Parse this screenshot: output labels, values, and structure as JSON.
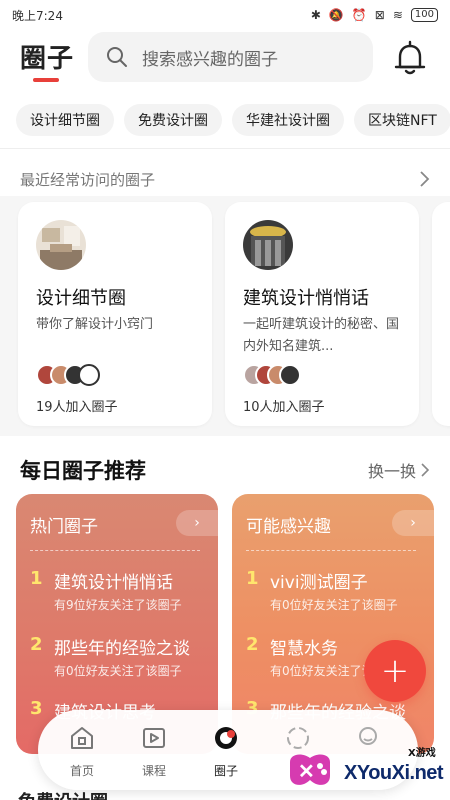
{
  "status": {
    "time": "晚上7:24",
    "battery": "100"
  },
  "header": {
    "title": "圈子",
    "search_placeholder": "搜索感兴趣的圈子"
  },
  "chips": [
    "设计细节圈",
    "免费设计圈",
    "华建社设计圈",
    "区块链NFT"
  ],
  "recent": {
    "heading": "最近经常访问的圈子",
    "cards": [
      {
        "title": "设计细节圈",
        "desc": "带你了解设计小窍门",
        "count": "19人加入圈子"
      },
      {
        "title": "建筑设计悄悄话",
        "desc": "一起听建筑设计的秘密、国内外知名建筑...",
        "count": "10人加入圈子"
      }
    ]
  },
  "daily": {
    "title": "每日圈子推荐",
    "refresh": "换一换",
    "panels": [
      {
        "head": "热门圈子",
        "items": [
          {
            "rank": "1",
            "name": "建筑设计悄悄话",
            "sub": "有9位好友关注了该圈子"
          },
          {
            "rank": "2",
            "name": "那些年的经验之谈",
            "sub": "有0位好友关注了该圈子"
          },
          {
            "rank": "3",
            "name": "建筑设计思考",
            "sub": ""
          }
        ]
      },
      {
        "head": "可能感兴趣",
        "items": [
          {
            "rank": "1",
            "name": "vivi测试圈子",
            "sub": "有0位好友关注了该圈子"
          },
          {
            "rank": "2",
            "name": "智慧水务",
            "sub": "有0位好友关注了该圈子"
          },
          {
            "rank": "3",
            "name": "那些年的经验之谈",
            "sub": ""
          }
        ]
      }
    ]
  },
  "tabs": [
    {
      "label": "首页"
    },
    {
      "label": "课程"
    },
    {
      "label": "圈子"
    },
    {
      "label": ""
    },
    {
      "label": ""
    }
  ],
  "watermark": {
    "brand": "XYouXi.net",
    "small": "X游戏"
  },
  "bottom_peek": "免费设计圈",
  "colors": {
    "accent": "#e8403a",
    "fab": "#f0483d"
  }
}
